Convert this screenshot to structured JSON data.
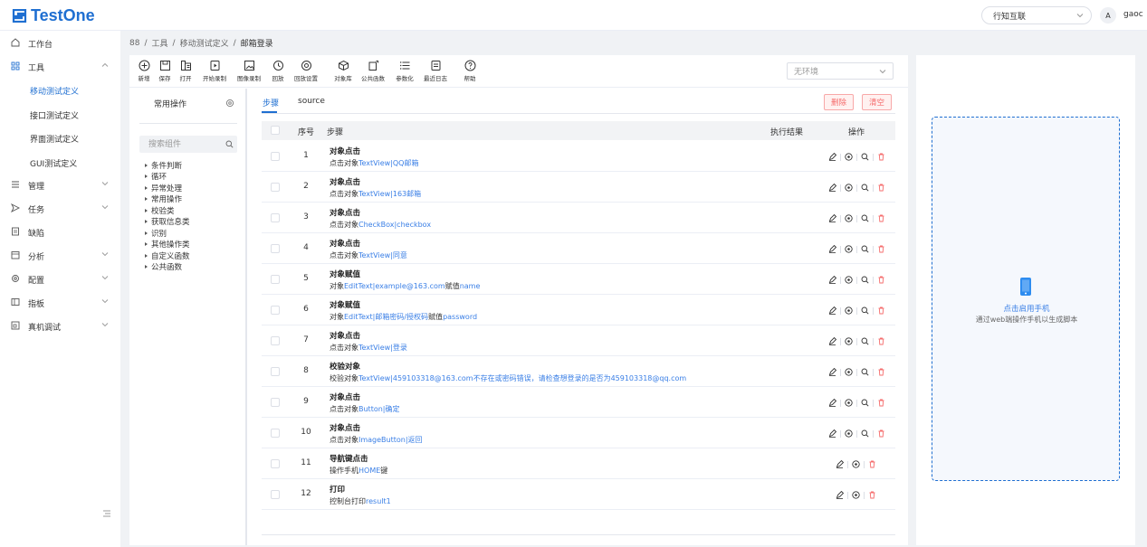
{
  "app": {
    "title": "TestOne"
  },
  "topbar": {
    "org": "行知互联",
    "lang_icon": "translate-icon",
    "lang_label": "A",
    "user": "gaoc"
  },
  "sidebar": {
    "items": [
      {
        "label": "工作台",
        "icon": "home-icon"
      },
      {
        "label": "工具",
        "icon": "grid-icon",
        "expanded": true
      },
      {
        "label": "管理",
        "icon": "list-icon"
      },
      {
        "label": "任务",
        "icon": "send-icon"
      },
      {
        "label": "缺陷",
        "icon": "document-icon"
      },
      {
        "label": "分析",
        "icon": "calendar-icon"
      },
      {
        "label": "配置",
        "icon": "gear-icon"
      },
      {
        "label": "指板",
        "icon": "board-icon"
      },
      {
        "label": "真机调试",
        "icon": "device-icon"
      }
    ],
    "tool_sub": [
      "移动测试定义",
      "接口测试定义",
      "界面测试定义",
      "GUI测试定义"
    ],
    "active_sub": 0
  },
  "breadcrumb": {
    "home": "88",
    "items": [
      "工具",
      "移动测试定义",
      "邮箱登录"
    ]
  },
  "toolbar": {
    "buttons": [
      {
        "label": "新增",
        "icon": "plus-circle-icon"
      },
      {
        "label": "保存",
        "icon": "save-icon"
      },
      {
        "label": "打开",
        "icon": "open-icon"
      },
      {
        "label": "开始录制",
        "icon": "record-icon"
      },
      {
        "label": "图像录制",
        "icon": "image-icon"
      },
      {
        "label": "回放",
        "icon": "replay-icon"
      },
      {
        "label": "回放设置",
        "icon": "settings-icon"
      },
      {
        "label": "对象库",
        "icon": "cube-icon"
      },
      {
        "label": "公共函数",
        "icon": "function-icon"
      },
      {
        "label": "参数化",
        "icon": "list-icon"
      },
      {
        "label": "最近日志",
        "icon": "log-icon"
      },
      {
        "label": "帮助",
        "icon": "help-icon"
      }
    ],
    "env_placeholder": "无环境"
  },
  "components": {
    "tab_label": "常用操作",
    "search_placeholder": "搜索组件",
    "tree": [
      "条件判断",
      "循环",
      "异常处理",
      "常用操作",
      "校验类",
      "获取信息类",
      "识别",
      "其他操作类",
      "自定义函数",
      "公共函数"
    ]
  },
  "steps": {
    "tabs": [
      "步骤",
      "source"
    ],
    "active_tab": 0,
    "delete_label": "删除",
    "clear_label": "清空",
    "headers": {
      "index": "序号",
      "step": "步骤",
      "result": "执行结果",
      "ops": "操作"
    },
    "rows": [
      {
        "index": "1",
        "title": "对象点击",
        "desc": [
          {
            "t": "点击对象",
            "h": false
          },
          {
            "t": "TextView|QQ邮箱",
            "h": true
          }
        ],
        "ops": 4
      },
      {
        "index": "2",
        "title": "对象点击",
        "desc": [
          {
            "t": "点击对象",
            "h": false
          },
          {
            "t": "TextView|163邮箱",
            "h": true
          }
        ],
        "ops": 4
      },
      {
        "index": "3",
        "title": "对象点击",
        "desc": [
          {
            "t": "点击对象",
            "h": false
          },
          {
            "t": "CheckBox|checkbox",
            "h": true
          }
        ],
        "ops": 4
      },
      {
        "index": "4",
        "title": "对象点击",
        "desc": [
          {
            "t": "点击对象",
            "h": false
          },
          {
            "t": "TextView|同意",
            "h": true
          }
        ],
        "ops": 4
      },
      {
        "index": "5",
        "title": "对象赋值",
        "desc": [
          {
            "t": "对象",
            "h": false
          },
          {
            "t": "EditText|example@163.com",
            "h": true
          },
          {
            "t": "赋值",
            "h": false
          },
          {
            "t": "name",
            "h": true
          }
        ],
        "ops": 4
      },
      {
        "index": "6",
        "title": "对象赋值",
        "desc": [
          {
            "t": "对象",
            "h": false
          },
          {
            "t": "EditText|邮箱密码/授权码",
            "h": true
          },
          {
            "t": "赋值",
            "h": false
          },
          {
            "t": "password",
            "h": true
          }
        ],
        "ops": 4
      },
      {
        "index": "7",
        "title": "对象点击",
        "desc": [
          {
            "t": "点击对象",
            "h": false
          },
          {
            "t": "TextView|登录",
            "h": true
          }
        ],
        "ops": 4
      },
      {
        "index": "8",
        "title": "校验对象",
        "desc": [
          {
            "t": "校验对象",
            "h": false
          },
          {
            "t": "TextView|459103318@163.com不存在或密码错误，请检查想登录的是否为459103318@qq.com",
            "h": true
          }
        ],
        "ops": 4
      },
      {
        "index": "9",
        "title": "对象点击",
        "desc": [
          {
            "t": "点击对象",
            "h": false
          },
          {
            "t": "Button|确定",
            "h": true
          }
        ],
        "ops": 4
      },
      {
        "index": "10",
        "title": "对象点击",
        "desc": [
          {
            "t": "点击对象",
            "h": false
          },
          {
            "t": "ImageButton|返回",
            "h": true
          }
        ],
        "ops": 4
      },
      {
        "index": "11",
        "title": "导航键点击",
        "desc": [
          {
            "t": "操作手机",
            "h": false
          },
          {
            "t": "HOME",
            "h": true
          },
          {
            "t": "键",
            "h": false
          }
        ],
        "ops": 3
      },
      {
        "index": "12",
        "title": "打印",
        "desc": [
          {
            "t": "控制台打印",
            "h": false
          },
          {
            "t": "result1",
            "h": true
          }
        ],
        "ops": 3
      }
    ]
  },
  "device": {
    "title": "点击启用手机",
    "subtitle": "通过web端操作手机以生成脚本"
  },
  "colors": {
    "primary": "#1f6fd1",
    "link": "#3a7fe6",
    "danger": "#f56c6c"
  }
}
